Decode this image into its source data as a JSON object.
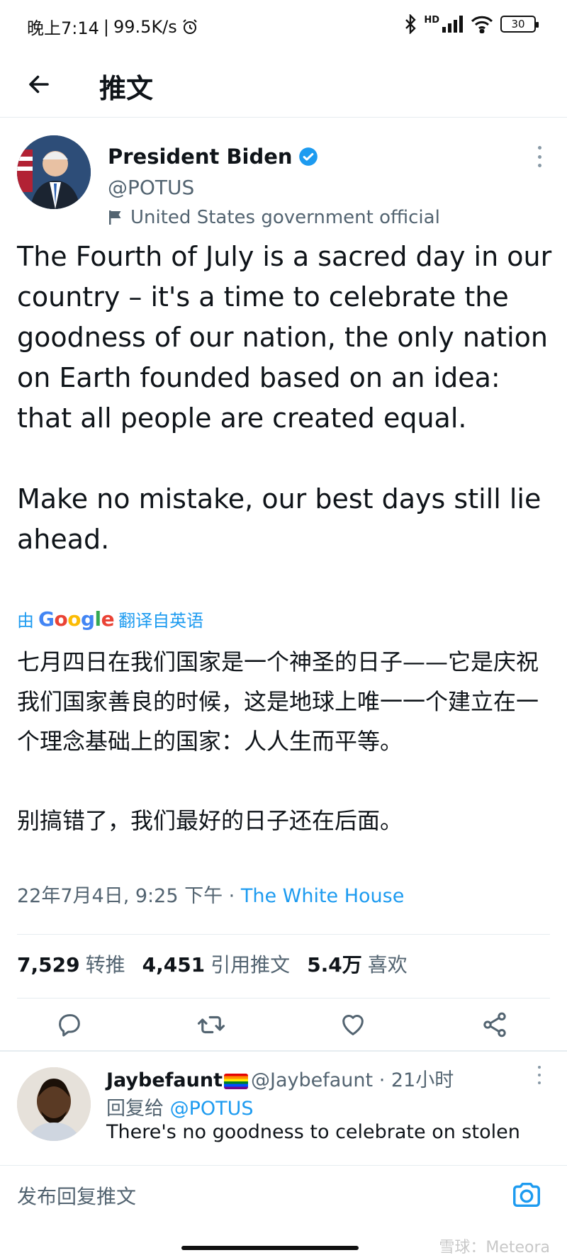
{
  "status_bar": {
    "time": "晚上7:14",
    "speed": "99.5K/s",
    "network": "HD",
    "battery": "30"
  },
  "header": {
    "title": "推文"
  },
  "tweet": {
    "author_name": "President Biden",
    "author_handle": "@POTUS",
    "gov_label": "United States government official",
    "text": "The Fourth of July is a sacred day in our country – it's a time to celebrate the goodness of our nation, the only nation on Earth founded based on an idea: that all people are created equal.\n\nMake no mistake, our best days still lie ahead.",
    "translate_prefix": "由",
    "translate_brand": "Google",
    "translate_suffix": "翻译自英语",
    "translated_text": "七月四日在我们国家是一个神圣的日子——它是庆祝我们国家善良的时候，这是地球上唯一一个建立在一个理念基础上的国家：人人生而平等。\n\n别搞错了，我们最好的日子还在后面。",
    "timestamp": "22年7月4日, 9:25 下午",
    "separator": " · ",
    "source": "The White House",
    "stats": {
      "retweets_count": "7,529",
      "retweets_label": "转推",
      "quotes_count": "4,451",
      "quotes_label": "引用推文",
      "likes_count": "5.4万",
      "likes_label": "喜欢"
    }
  },
  "reply": {
    "name": "Jaybefaunt",
    "handle": "@Jaybefaunt",
    "time": " · 21小时",
    "reply_to_label": "回复给",
    "reply_to_mention": "@POTUS",
    "text": "There's no goodness to celebrate  on stolen"
  },
  "compose": {
    "placeholder": "发布回复推文"
  },
  "watermark": "雪球：Meteora",
  "colors": {
    "accent": "#1d9bf0",
    "text": "#0f1419",
    "secondary": "#536471"
  }
}
